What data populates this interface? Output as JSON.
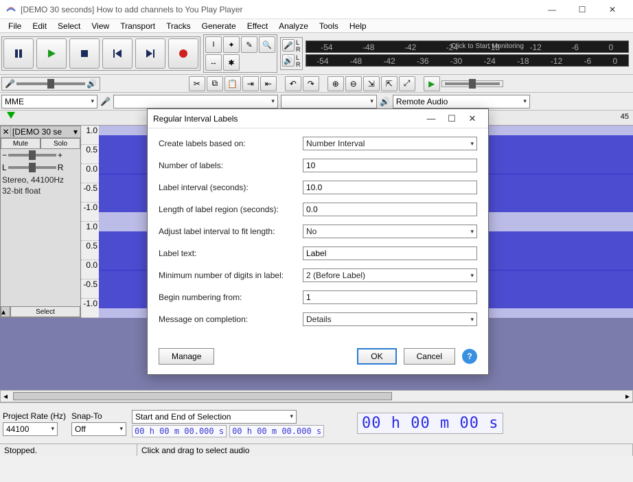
{
  "window": {
    "title": "[DEMO 30 seconds] How to add channels to You Play Player"
  },
  "menu": [
    "File",
    "Edit",
    "Select",
    "View",
    "Transport",
    "Tracks",
    "Generate",
    "Effect",
    "Analyze",
    "Tools",
    "Help"
  ],
  "meter": {
    "ticks": [
      "-54",
      "-48",
      "-42",
      "-36",
      "-30",
      "-24",
      "-18",
      "-12",
      "-6",
      "0"
    ],
    "monitor": "Click to Start Monitoring"
  },
  "devices": {
    "host": "MME",
    "output": "Remote Audio"
  },
  "ruler_end": "45",
  "track": {
    "name": "[DEMO 30 se",
    "mute": "Mute",
    "solo": "Solo",
    "info1": "Stereo, 44100Hz",
    "info2": "32-bit float",
    "select": "Select",
    "vscale": [
      "1.0",
      "0.5",
      "0.0",
      "-0.5",
      "-1.0"
    ]
  },
  "bottom": {
    "project_rate_label": "Project Rate (Hz)",
    "project_rate": "44100",
    "snap_label": "Snap-To",
    "snap": "Off",
    "sel_label": "Start and End of Selection",
    "sel_start": "00 h 00 m 00.000 s",
    "sel_end": "00 h 00 m 00.000 s",
    "bigtime": "00 h 00 m 00 s"
  },
  "status": {
    "left": "Stopped.",
    "hint": "Click and drag to select audio"
  },
  "dialog": {
    "title": "Regular Interval Labels",
    "rows": {
      "based_on_label": "Create labels based on:",
      "based_on": "Number  Interval",
      "num_label": "Number of labels:",
      "num": "10",
      "interval_label": "Label interval (seconds):",
      "interval": "10.0",
      "region_label": "Length of label region (seconds):",
      "region": "0.0",
      "adjust_label": "Adjust label interval to fit length:",
      "adjust": "No",
      "text_label": "Label text:",
      "text": "Label",
      "digits_label": "Minimum number of digits in label:",
      "digits": "2 (Before Label)",
      "begin_label": "Begin numbering from:",
      "begin": "1",
      "msg_label": "Message on completion:",
      "msg": "Details"
    },
    "manage": "Manage",
    "ok": "OK",
    "cancel": "Cancel"
  }
}
